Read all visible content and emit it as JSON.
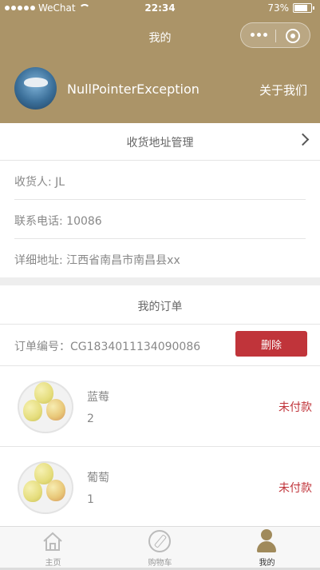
{
  "status_bar": {
    "carrier": "WeChat",
    "time": "22:34",
    "battery": "73%",
    "battery_level": 0.73
  },
  "navbar": {
    "title": "我的"
  },
  "profile": {
    "username": "NullPointerException",
    "about_link": "关于我们"
  },
  "address": {
    "section_title": "收货地址管理",
    "recipient": "收货人: JL",
    "phone": "联系电话: 10086",
    "detail": "详细地址: 江西省南昌市南昌县xx"
  },
  "orders": {
    "section_title": "我的订单",
    "order_number": "订单编号：CG1834011134090086",
    "delete_label": "删除",
    "items": [
      {
        "name": "蓝莓",
        "quantity": "2",
        "status": "未付款"
      },
      {
        "name": "葡萄",
        "quantity": "1",
        "status": "未付款"
      }
    ]
  },
  "tabbar": {
    "tabs": [
      {
        "label": "主页",
        "icon": "home-icon"
      },
      {
        "label": "购物车",
        "icon": "compass-icon"
      },
      {
        "label": "我的",
        "icon": "user-icon"
      }
    ]
  },
  "colors": {
    "header_bg": "#ab9468",
    "accent": "#c0343a",
    "active_tab": "#a08a5b"
  }
}
